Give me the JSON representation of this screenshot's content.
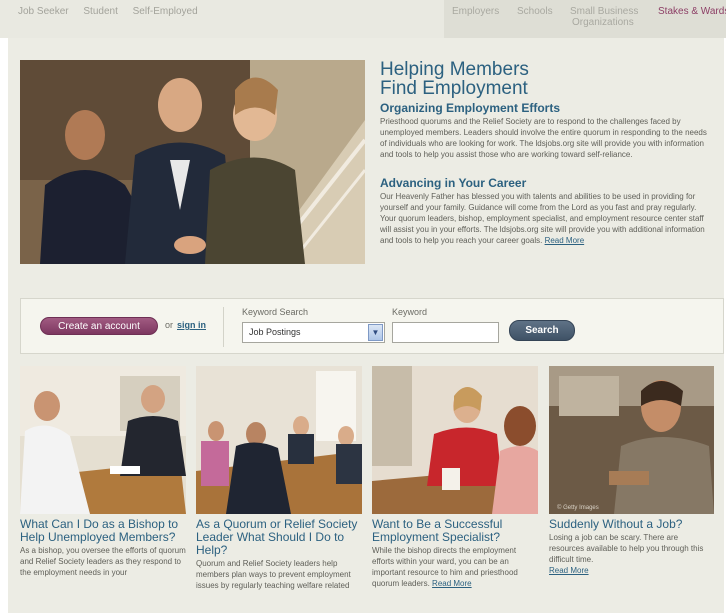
{
  "topnav": {
    "left": [
      "Job Seeker",
      "Student",
      "Self-Employed"
    ],
    "right": {
      "employers": "Employers",
      "schools": "Schools",
      "small_business": "Small Business",
      "organizations": "Organizations",
      "stakes": "Stakes & Wards"
    }
  },
  "hero": {
    "title_line1": "Helping Members",
    "title_line2": "Find Employment",
    "section1": {
      "title": "Organizing Employment Efforts",
      "body": "Priesthood quorums and the Relief Society are to respond to the challenges faced by unemployed members. Leaders should involve the entire quorum in responding to the needs of individuals who are looking for work. The ldsjobs.org site will provide you with information and tools to help you assist those who are working toward self-reliance."
    },
    "section2": {
      "title": "Advancing in Your Career",
      "body": "Our Heavenly Father has blessed you with talents and abilities to be used in providing for yourself and your family. Guidance will come from the Lord as you fast and pray regularly. Your quorum leaders, bishop, employment specialist, and employment resource center staff will assist you in your efforts. The ldsjobs.org site will provide you with additional information and tools to help you reach your career goals.",
      "link": "Read More"
    }
  },
  "searchbar": {
    "create_account": "Create an account",
    "or": "or",
    "sign_in": "sign in",
    "keyword_search_label": "Keyword Search",
    "selected_option": "Job Postings",
    "keyword_label": "Keyword",
    "keyword_value": "",
    "search_button": "Search"
  },
  "cards": [
    {
      "title": "What Can I Do as a Bishop to Help Unemployed Members?",
      "body": "As a bishop, you oversee the efforts of quorum and Relief Society leaders as they respond to the employment needs in your"
    },
    {
      "title": "As a Quorum or Relief Society Leader What Should I Do to Help?",
      "body": "Quorum and Relief Society leaders help members plan ways to prevent employment issues by regularly teaching welfare related"
    },
    {
      "title": "Want to Be a Successful Employment Specialist?",
      "body": "While the bishop directs the employment efforts within your ward, you can be an important resource to him and priesthood quorum leaders.",
      "link": "Read More"
    },
    {
      "title": "Suddenly Without a Job?",
      "body": "Losing a job can be scary. There are resources available to help you through this difficult time.",
      "link": "Read More",
      "watermark": "© Getty Images"
    }
  ],
  "colors": {
    "heading_blue": "#2c6180",
    "account_button": "#8d4670",
    "search_button": "#4b5e72",
    "panel_bg": "#ecece4"
  }
}
